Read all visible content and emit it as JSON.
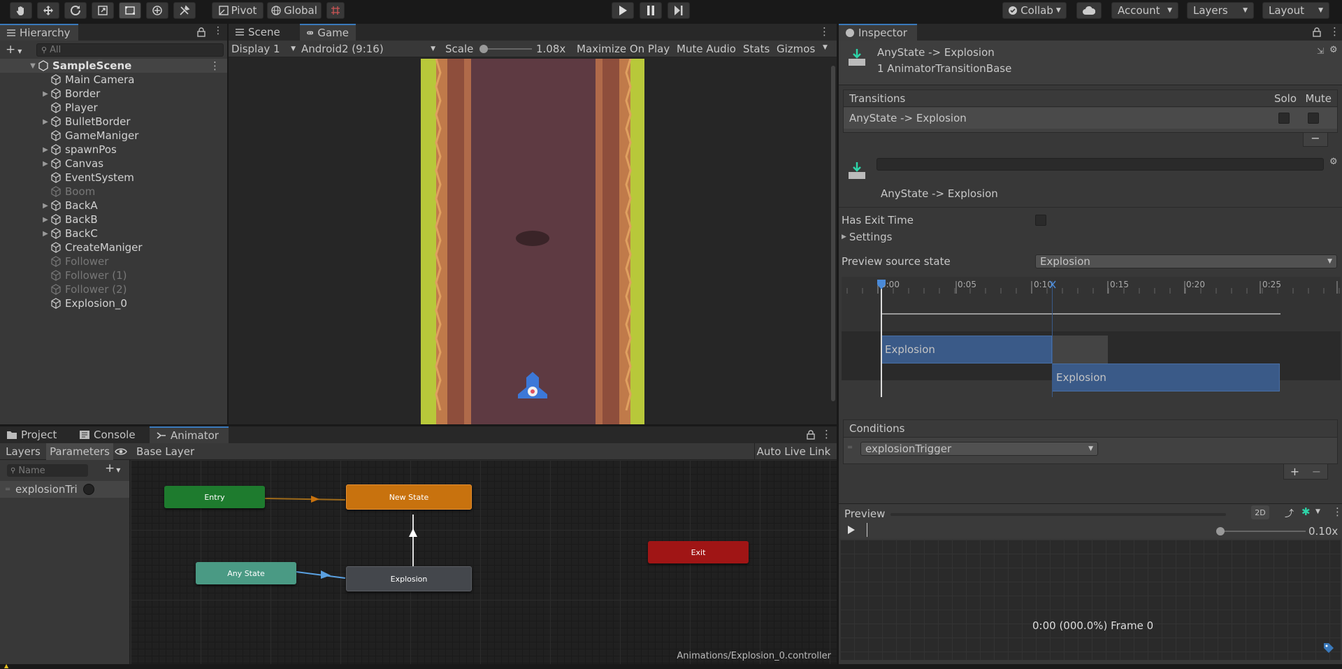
{
  "toolbar": {
    "pivot": "Pivot",
    "global": "Global",
    "collab": "Collab",
    "account": "Account",
    "layers": "Layers",
    "layout": "Layout"
  },
  "hierarchy": {
    "title": "Hierarchy",
    "search_placeholder": "All",
    "scene": "SampleScene",
    "items": [
      {
        "label": "Main Camera",
        "arrow": false,
        "disabled": false
      },
      {
        "label": "Border",
        "arrow": true,
        "disabled": false
      },
      {
        "label": "Player",
        "arrow": false,
        "disabled": false
      },
      {
        "label": "BulletBorder",
        "arrow": true,
        "disabled": false
      },
      {
        "label": "GameManiger",
        "arrow": false,
        "disabled": false
      },
      {
        "label": "spawnPos",
        "arrow": true,
        "disabled": false
      },
      {
        "label": "Canvas",
        "arrow": true,
        "disabled": false
      },
      {
        "label": "EventSystem",
        "arrow": false,
        "disabled": false
      },
      {
        "label": "Boom",
        "arrow": false,
        "disabled": true
      },
      {
        "label": "BackA",
        "arrow": true,
        "disabled": false
      },
      {
        "label": "BackB",
        "arrow": true,
        "disabled": false
      },
      {
        "label": "BackC",
        "arrow": true,
        "disabled": false
      },
      {
        "label": "CreateManiger",
        "arrow": false,
        "disabled": false
      },
      {
        "label": "Follower",
        "arrow": false,
        "disabled": true
      },
      {
        "label": "Follower (1)",
        "arrow": false,
        "disabled": true
      },
      {
        "label": "Follower (2)",
        "arrow": false,
        "disabled": true
      },
      {
        "label": "Explosion_0",
        "arrow": false,
        "disabled": false
      }
    ]
  },
  "game": {
    "tab_scene": "Scene",
    "tab_game": "Game",
    "display": "Display 1",
    "resolution": "Android2 (9:16)",
    "scale_label": "Scale",
    "scale_value": "1.08x",
    "maximize": "Maximize On Play",
    "mute": "Mute Audio",
    "stats": "Stats",
    "gizmos": "Gizmos"
  },
  "animator": {
    "tab_project": "Project",
    "tab_console": "Console",
    "tab_animator": "Animator",
    "layers_tab": "Layers",
    "parameters_tab": "Parameters",
    "base_layer": "Base Layer",
    "auto_live_link": "Auto Live Link",
    "name_placeholder": "Name",
    "param": "explosionTri",
    "path": "Animations/Explosion_0.controller",
    "nodes": {
      "entry": "Entry",
      "new_state": "New State",
      "exit": "Exit",
      "any_state": "Any State",
      "explosion": "Explosion"
    }
  },
  "inspector": {
    "title": "Inspector",
    "header_title": "AnyState -> Explosion",
    "header_sub": "1 AnimatorTransitionBase",
    "transitions": "Transitions",
    "solo": "Solo",
    "mute": "Mute",
    "transition_item": "AnyState -> Explosion",
    "transition_name": "AnyState -> Explosion",
    "has_exit_time": "Has Exit Time",
    "settings": "Settings",
    "preview_source": "Preview source state",
    "preview_value": "Explosion",
    "timeline_ticks": [
      "0:00",
      "0:05",
      "0:10",
      "0:15",
      "0:20",
      "0:25"
    ],
    "clip_a": "Explosion",
    "clip_b": "Explosion",
    "conditions": "Conditions",
    "condition_value": "explosionTrigger",
    "preview_title": "Preview",
    "preview_2d": "2D",
    "speed": "0.10x",
    "frame_info": "0:00 (000.0%) Frame 0"
  },
  "colors": {
    "entry": "#1e7b2e",
    "new_state": "#c8720e",
    "exit": "#a01515",
    "any_state": "#4a9a84",
    "explosion": "#44474c",
    "accent": "#3a79bb"
  }
}
